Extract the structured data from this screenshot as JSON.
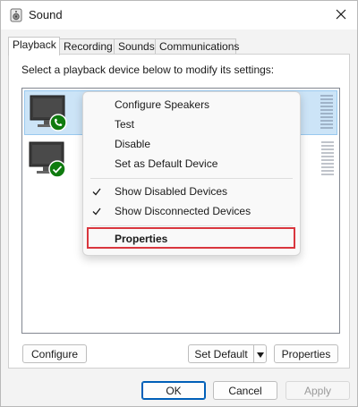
{
  "window": {
    "title": "Sound",
    "title_icon": "speaker-icon",
    "close_icon": "close-icon"
  },
  "tabs": [
    {
      "label": "Playback",
      "active": true
    },
    {
      "label": "Recording",
      "active": false
    },
    {
      "label": "Sounds",
      "active": false
    },
    {
      "label": "Communications",
      "active": false
    }
  ],
  "panel": {
    "instruction": "Select a playback device below to modify its settings:"
  },
  "devices": [
    {
      "icon": "monitor-icon",
      "badge": "phone-badge-icon",
      "selected": true
    },
    {
      "icon": "monitor-icon",
      "badge": "check-badge-icon",
      "selected": false
    }
  ],
  "context_menu": {
    "items": [
      {
        "label": "Configure Speakers"
      },
      {
        "label": "Test"
      },
      {
        "label": "Disable"
      },
      {
        "label": "Set as Default Device"
      }
    ],
    "toggles": [
      {
        "label": "Show Disabled Devices",
        "checked": true
      },
      {
        "label": "Show Disconnected Devices",
        "checked": true
      }
    ],
    "default_item": {
      "label": "Properties"
    },
    "highlight_color": "#d9363e"
  },
  "panel_buttons": {
    "configure": "Configure",
    "set_default": "Set Default",
    "properties": "Properties"
  },
  "dialog_buttons": {
    "ok": "OK",
    "cancel": "Cancel",
    "apply": "Apply"
  },
  "colors": {
    "accent": "#005fb8",
    "selected_row": "#cce4f7",
    "badge_green": "#0f7b0f"
  }
}
